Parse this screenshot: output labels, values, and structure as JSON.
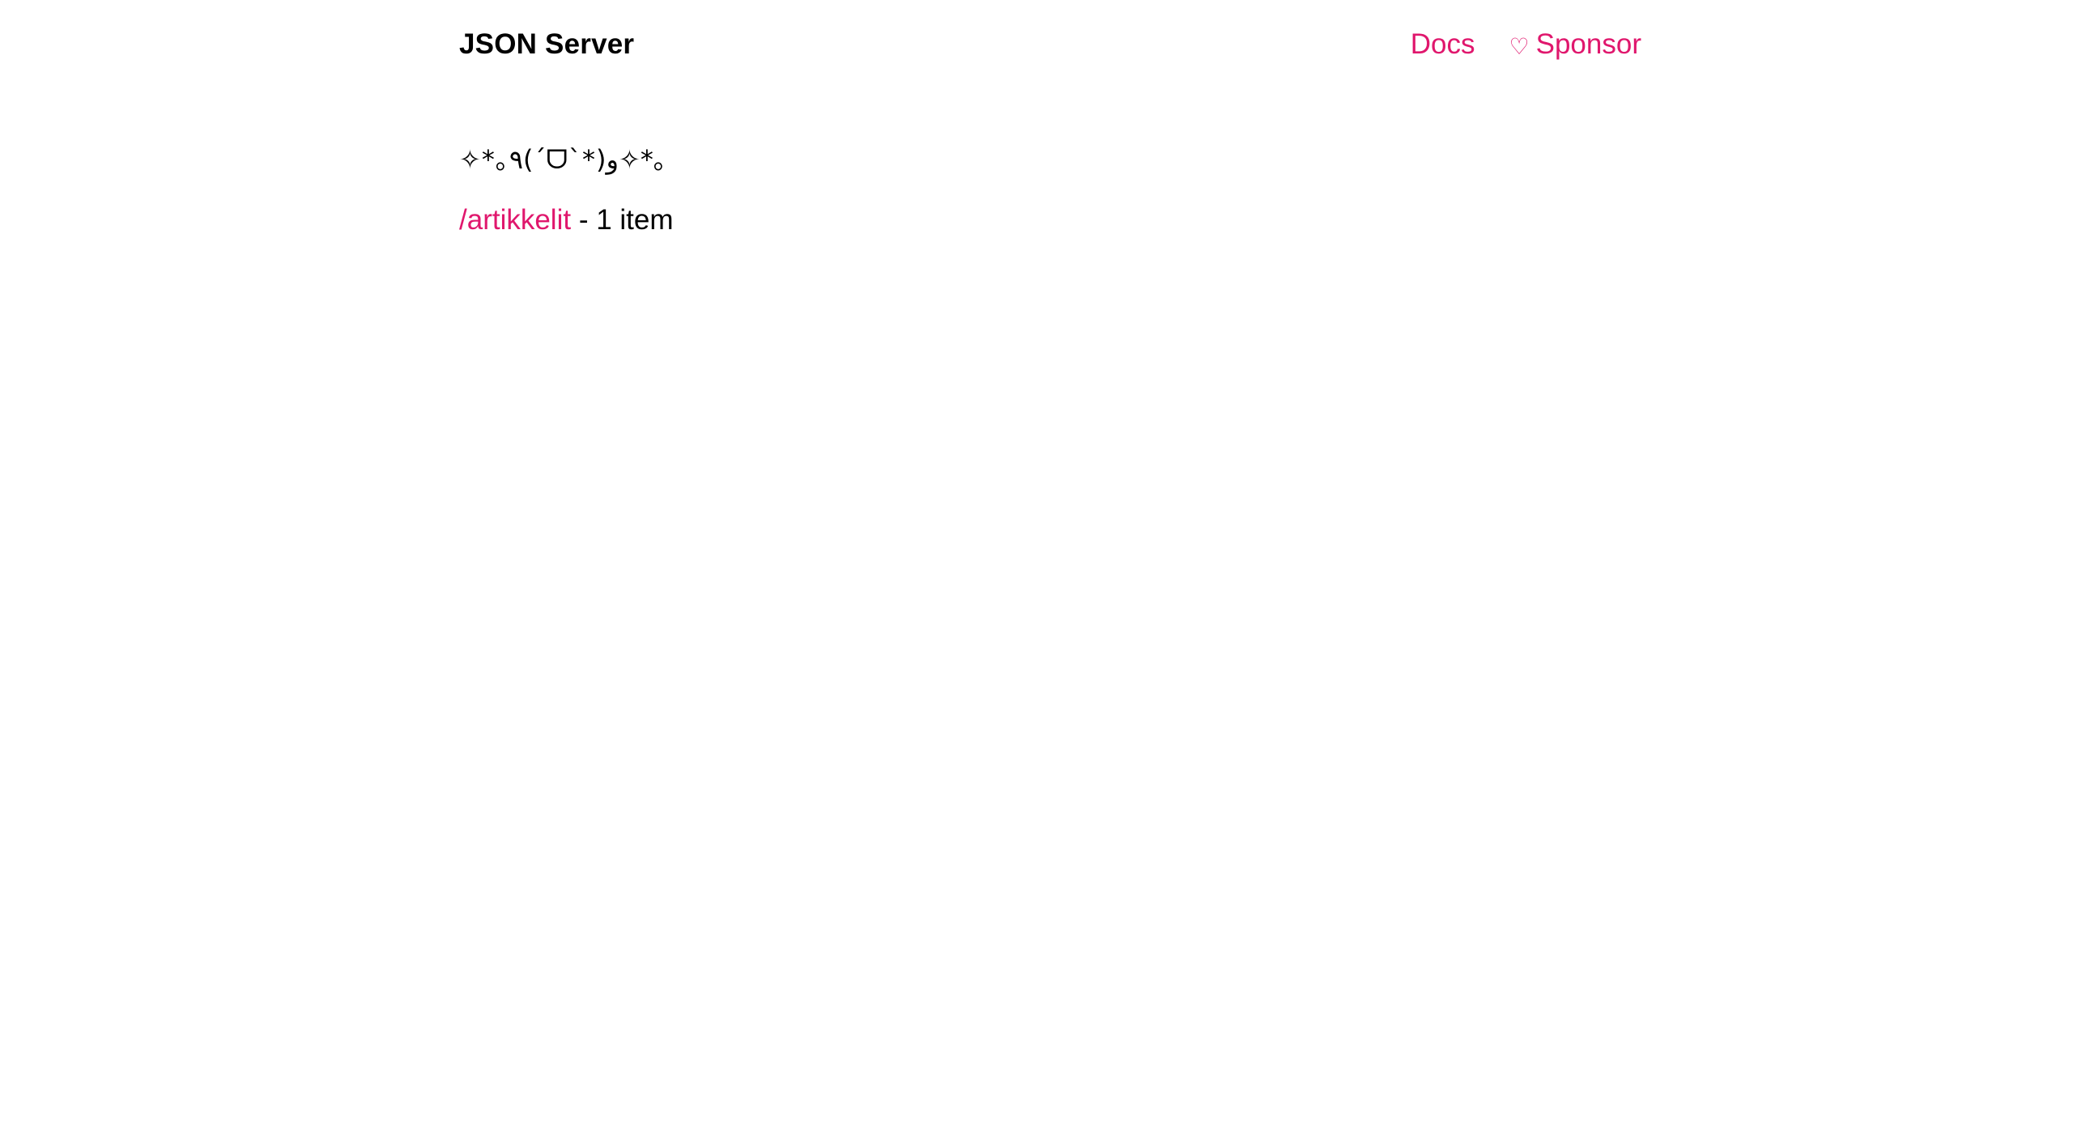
{
  "header": {
    "brand": "JSON Server",
    "nav": {
      "docs_label": "Docs",
      "sponsor_icon": "heart-outline-icon",
      "sponsor_label": "Sponsor"
    }
  },
  "main": {
    "kaomoji": "✧*｡٩(ˊᗜˋ*)و✧*｡",
    "resources": [
      {
        "path": "/artikkelit",
        "separator": " - ",
        "count_label": "1 item"
      }
    ]
  },
  "colors": {
    "accent": "#e0176d",
    "text": "#000000",
    "background": "#ffffff"
  }
}
